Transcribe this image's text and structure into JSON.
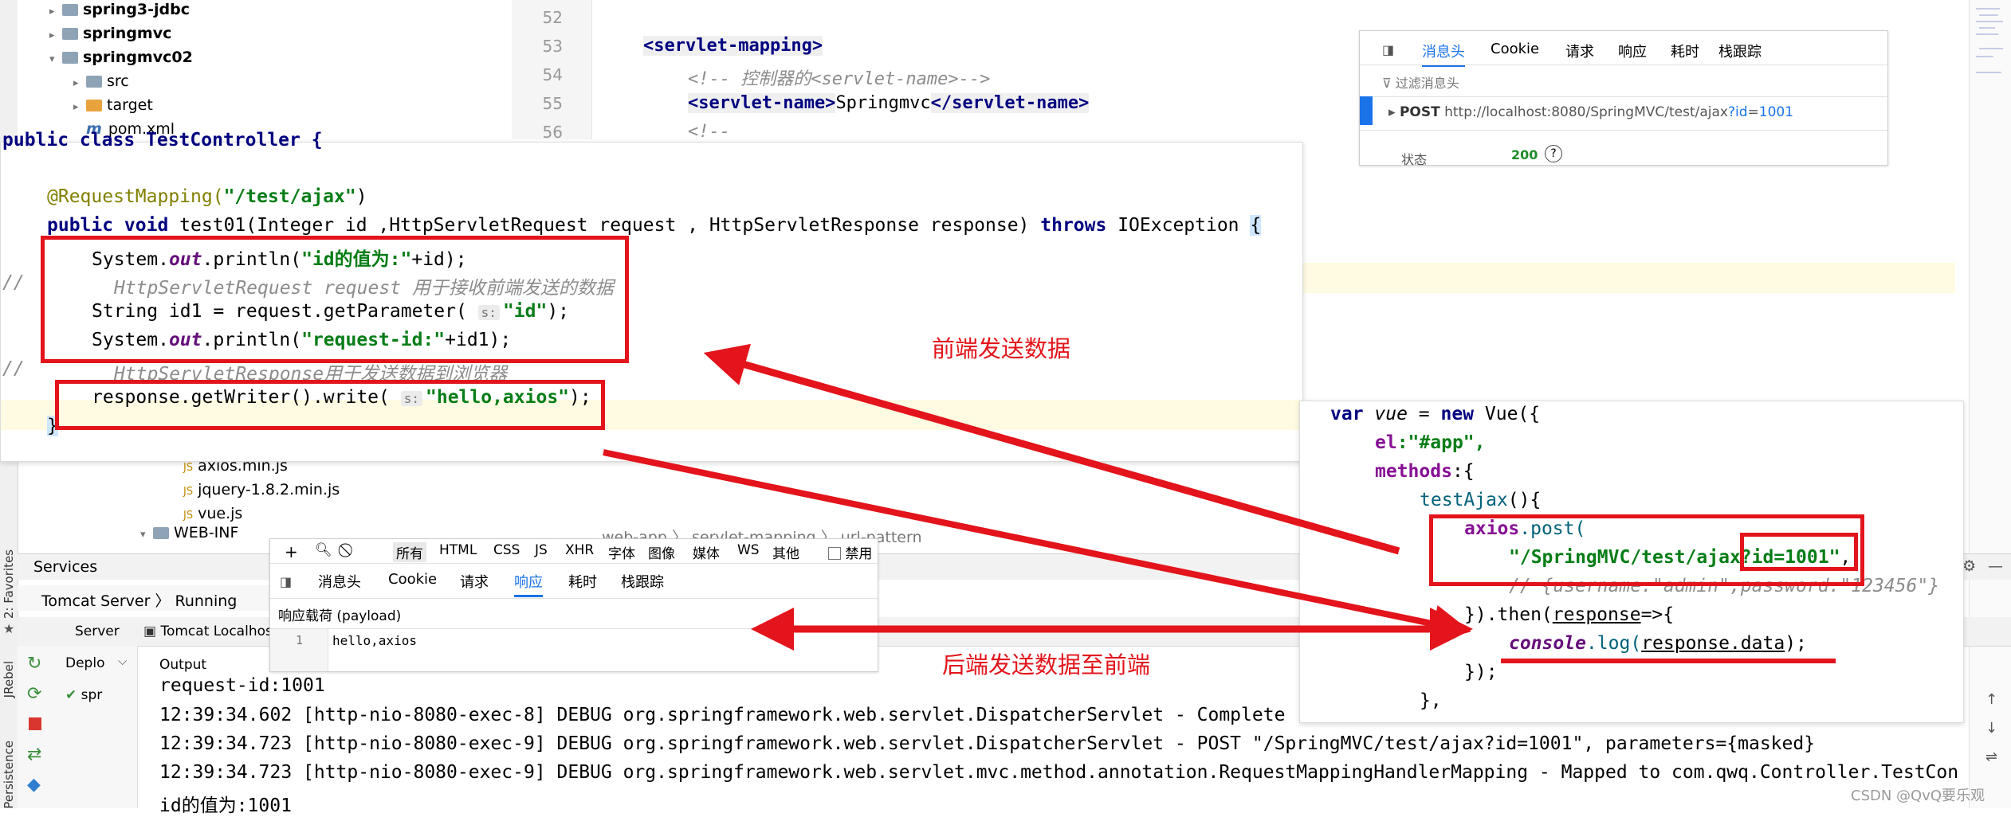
{
  "project_tree": [
    {
      "indent": 1,
      "expanded": false,
      "icon": "folder",
      "label": "spring3-jdbc",
      "bold": true
    },
    {
      "indent": 1,
      "expanded": false,
      "icon": "folder",
      "label": "springmvc",
      "bold": true
    },
    {
      "indent": 1,
      "expanded": true,
      "icon": "folder",
      "label": "springmvc02",
      "bold": true
    },
    {
      "indent": 2,
      "expanded": false,
      "icon": "folder",
      "label": "src",
      "bold": false
    },
    {
      "indent": 2,
      "expanded": false,
      "icon": "folder-orange",
      "label": "target",
      "bold": false
    },
    {
      "indent": 2,
      "expanded": null,
      "icon": "maven-icon",
      "label": "pom.xml",
      "bold": false
    }
  ],
  "xml_editor": {
    "line_numbers": [
      "52",
      "53",
      "54",
      "55",
      "56"
    ],
    "line53_tag": "<servlet-mapping>",
    "line54_comment": "<!--        控制器的<servlet-name>-->",
    "line55_open": "<servlet-name>",
    "line55_value": "Springmvc",
    "line55_close": "</servlet-name>",
    "line56_comment": "<!--"
  },
  "devtools_top": {
    "tabs": [
      "消息头",
      "Cookie",
      "请求",
      "响应",
      "耗时",
      "栈跟踪"
    ],
    "active_tab": "消息头",
    "filter_placeholder": "过滤消息头",
    "method": "POST",
    "url_base": "http://localhost:8080/SpringMVC/test/ajax",
    "url_query": "?id",
    "url_eq": "=",
    "url_value": "1001",
    "status_label": "状态",
    "status_value": "200",
    "help": "?"
  },
  "java_code": {
    "l0": "public class TestController {",
    "l1_ann": "@RequestMapping(",
    "l1_str": "\"/test/ajax\"",
    "l1_end": ")",
    "l2_kw1": "public void",
    "l2_mid": " test01(Integer id ,HttpServletRequest request , HttpServletResponse response) ",
    "l2_kw2": "throws",
    "l2_end": " IOException ",
    "l2_brace": "{",
    "l3_a": "System.",
    "l3_out": "out",
    "l3_b": ".println(",
    "l3_str": "\"id的值为:\"",
    "l3_c": "+id);",
    "l4_slash": "//",
    "l4_text": "HttpServletRequest request  用于接收前端发送的数据",
    "l5_a": "String id1 = request.getParameter(",
    "l5_hint": "s:",
    "l5_str": "\"id\"",
    "l5_c": ");",
    "l6_a": "System.",
    "l6_out": "out",
    "l6_b": ".println(",
    "l6_str": "\"request-id:\"",
    "l6_c": "+id1);",
    "l7_slash": "//",
    "l7_text": "HttpServletResponse用于发送数据到浏览器",
    "l8_a": "response.getWriter().write(",
    "l8_hint": "s:",
    "l8_str": "\"hello,axios\"",
    "l8_c": ");",
    "l9": "}"
  },
  "annotations": {
    "frontend_label": "前端发送数据",
    "backend_label": "后端发送数据至前端"
  },
  "middle_tree": [
    {
      "label": "axios.min.js"
    },
    {
      "label": "jquery-1.8.2.min.js"
    },
    {
      "label": "vue.js"
    },
    {
      "label": "WEB-INF"
    }
  ],
  "breadcrumb_editor": [
    "web-app",
    "servlet-mapping",
    "url-pattern"
  ],
  "vue_code": {
    "v1_kw": "var",
    "v1_name": " vue",
    "v1_eq": " = ",
    "v1_new": "new",
    "v1_end": " Vue({",
    "v2_prop": "el",
    "v2_str": ":\"#app\",",
    "v3_prop": "methods",
    "v3_end": ":{",
    "v4_fn": "testAjax",
    "v4_end": "(){",
    "v5_a": "axios",
    "v5_b": ".post(",
    "v6_str1": "\"/SpringMVC/test/ajax",
    "v6_str2": "?id=1001\"",
    "v6_end": ",",
    "v7_cmt": "// {username:\"admin\",password:\"123456\"}",
    "v8_a": "}).then(",
    "v8_b": "response",
    "v8_c": "=>{",
    "v9_a": "console",
    "v9_b": ".log(",
    "v9_c": "response.data",
    "v9_d": ");",
    "v10": "});",
    "v11": "},"
  },
  "services": {
    "title": "Services",
    "breadcrumb": [
      "Tomcat Server",
      "Running"
    ],
    "tabs": [
      "Server",
      "Tomcat Localhos"
    ],
    "deploy_label": "Deplo",
    "output_label": "Output",
    "deploy_item": "spr"
  },
  "devtools_bottom": {
    "filters": [
      "所有",
      "HTML",
      "CSS",
      "JS",
      "XHR",
      "字体",
      "图像",
      "媒体",
      "WS",
      "其他"
    ],
    "active_filter": "所有",
    "disable_label": "禁用",
    "tabs": [
      "消息头",
      "Cookie",
      "请求",
      "响应",
      "耗时",
      "栈跟踪"
    ],
    "active_tab": "响应",
    "payload_label": "响应载荷 (payload)",
    "line_no": "1",
    "payload_value": "hello,axios"
  },
  "console_log": [
    "request-id:1001",
    "12:39:34.602 [http-nio-8080-exec-8] DEBUG org.springframework.web.servlet.DispatcherServlet - Complete",
    "12:39:34.723 [http-nio-8080-exec-9] DEBUG org.springframework.web.servlet.DispatcherServlet - POST \"/SpringMVC/test/ajax?id=1001\", parameters={masked}",
    "12:39:34.723 [http-nio-8080-exec-9] DEBUG org.springframework.web.servlet.mvc.method.annotation.RequestMappingHandlerMapping - Mapped to com.qwq.Controller.TestCon",
    "id的值为:1001"
  ],
  "side_labels": {
    "favorites": "2: Favorites",
    "jrebel": "JRebel",
    "persistence": "Persistence"
  },
  "watermark": "CSDN @QvQ要乐观",
  "colors": {
    "annotation_red": "#e3141b",
    "devtools_blue": "#1a73e8",
    "status_green": "#1f8c2a"
  }
}
